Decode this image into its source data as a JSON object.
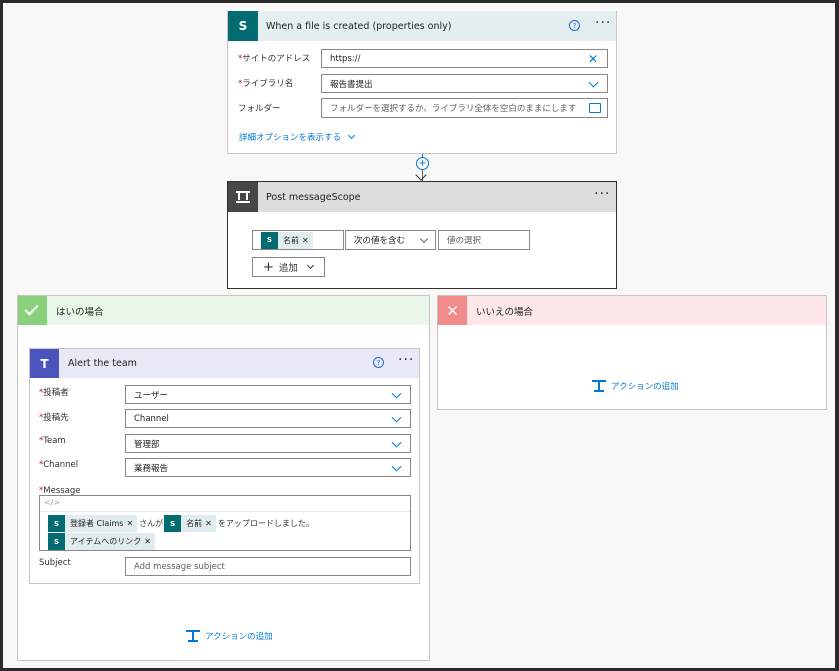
{
  "trigger": {
    "title": "When a file is created (properties only)",
    "site_label": "サイトのアドレス",
    "site_value": "https://",
    "library_label": "ライブラリ名",
    "library_value": "報告書提出",
    "folder_label": "フォルダー",
    "folder_placeholder": "フォルダーを選択するか、ライブラリ全体を空白のままにします",
    "advanced_link": "詳細オプションを表示する"
  },
  "scope": {
    "title": "Post messageScope",
    "token_label": "名前",
    "operator": "次の値を含む",
    "value_placeholder": "値の選択",
    "add_label": "追加"
  },
  "yes_branch": {
    "title": "はいの場合",
    "add_action": "アクションの追加",
    "alert": {
      "title": "Alert the team",
      "poster_label": "投稿者",
      "poster_value": "ユーザー",
      "post_in_label": "投稿先",
      "post_in_value": "Channel",
      "team_label": "Team",
      "team_value": "管理部",
      "channel_label": "Channel",
      "channel_value": "業務報告",
      "message_label": "Message",
      "code_icon": "</>",
      "token1": "登録者 Claims",
      "text1": "さんが",
      "token2": "名前",
      "text2": "をアップロードしました。",
      "token3": "アイテムへのリンク",
      "subject_label": "Subject",
      "subject_placeholder": "Add message subject"
    }
  },
  "no_branch": {
    "title": "いいえの場合",
    "add_action": "アクションの追加"
  },
  "icons": {
    "sharepoint": "sharepoint-icon",
    "scope": "scope-icon",
    "teams": "teams-icon",
    "check": "check-icon",
    "cross": "x-icon"
  },
  "colors": {
    "accent": "#0078d4",
    "sharepoint": "#036c70",
    "teams": "#4b53bc",
    "yes_header": "#e9f7e8",
    "yes_icon": "#8ad17e",
    "no_header": "#fde7e9",
    "no_icon": "#f28b8b",
    "required": "#a4262c"
  }
}
